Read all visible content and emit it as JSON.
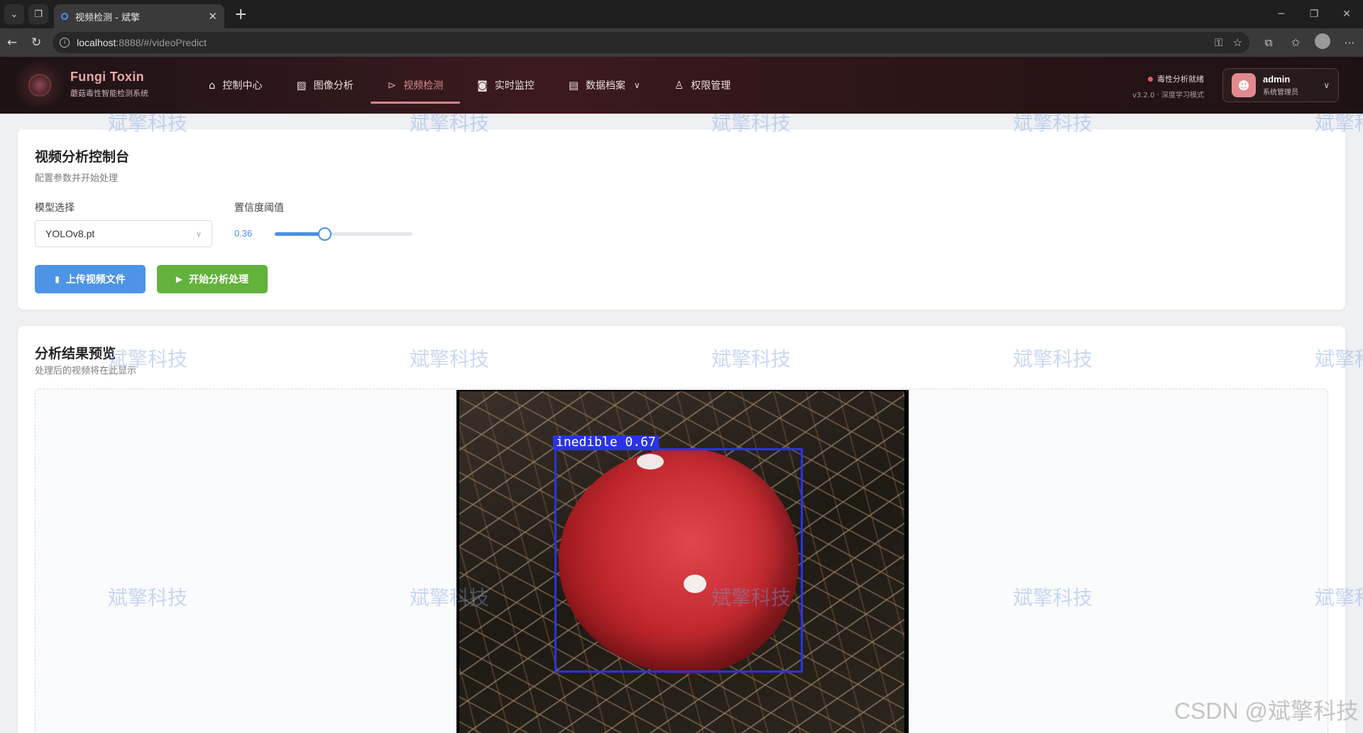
{
  "browser": {
    "tab_title": "视频检测 - 斌擎",
    "url_host": "localhost",
    "url_path": ":8888/#/videoPredict"
  },
  "header": {
    "brand_title": "Fungi Toxin",
    "brand_subtitle": "蘑菇毒性智能检测系统",
    "menu": [
      {
        "label": "控制中心",
        "icon": "home-icon"
      },
      {
        "label": "图像分析",
        "icon": "image-icon"
      },
      {
        "label": "视频检测",
        "icon": "play-circle-icon"
      },
      {
        "label": "实时监控",
        "icon": "camera-icon"
      },
      {
        "label": "数据档案",
        "icon": "document-icon"
      },
      {
        "label": "权限管理",
        "icon": "user-icon"
      }
    ],
    "status_text": "毒性分析就绪",
    "version_text": "v3.2.0 · 深度学习模式",
    "user_name": "admin",
    "user_role": "系统管理员",
    "accent_color": "#d9838a"
  },
  "control_panel": {
    "title": "视频分析控制台",
    "subtitle": "配置参数并开始处理",
    "model_label": "模型选择",
    "model_value": "YOLOv8.pt",
    "confidence_label": "置信度阈值",
    "confidence_value": "0.36",
    "confidence_fraction": 0.36,
    "upload_button": "上传视频文件",
    "start_button": "开始分析处理"
  },
  "results": {
    "title": "分析结果预览",
    "subtitle": "处理后的视频将在此显示",
    "detection_label": "inedible  0.67"
  },
  "watermark": "斌擎科技",
  "footer_watermark": "CSDN @斌擎科技"
}
